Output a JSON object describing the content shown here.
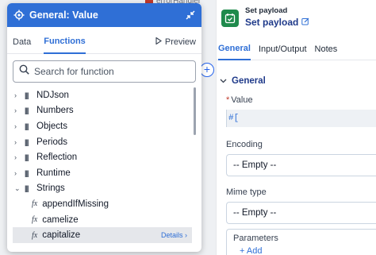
{
  "canvas": {
    "node_label": "errorHandler"
  },
  "popup": {
    "title": "General: Value",
    "tabs": [
      {
        "label": "Data",
        "active": false
      },
      {
        "label": "Functions",
        "active": true
      }
    ],
    "preview_label": "Preview",
    "search_placeholder": "Search for function",
    "categories": [
      "NDJson",
      "Numbers",
      "Objects",
      "Periods",
      "Reflection",
      "Runtime",
      "Strings"
    ],
    "expanded_category": "Strings",
    "functions": [
      "appendIfMissing",
      "camelize",
      "capitalize"
    ],
    "selected_function": "capitalize",
    "details_label": "Details ›",
    "fx_symbol": "fx"
  },
  "panel": {
    "component_type": "Set payload",
    "component_name": "Set payload",
    "tabs": [
      {
        "label": "General",
        "active": true
      },
      {
        "label": "Input/Output",
        "active": false
      },
      {
        "label": "Notes",
        "active": false
      }
    ],
    "section_title": "General",
    "value_label": "Value",
    "value_required_marker": "*",
    "value_text": "#[",
    "encoding_label": "Encoding",
    "encoding_value": "-- Empty --",
    "mime_label": "Mime type",
    "mime_value": "-- Empty --",
    "params_label": "Parameters",
    "add_label": "+ Add"
  },
  "colors": {
    "accent": "#2f6fd6",
    "header": "#2f6fd6",
    "app_icon": "#1f8a4c",
    "required": "#c0392b"
  }
}
